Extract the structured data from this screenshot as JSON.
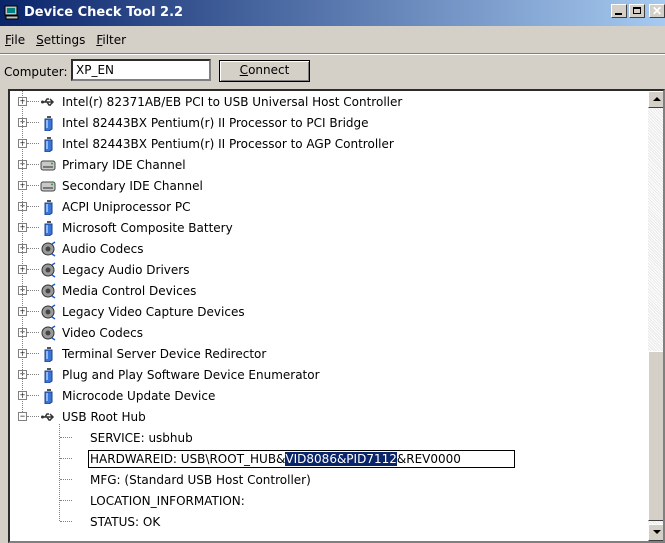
{
  "window": {
    "title": "Device Check Tool 2.2",
    "close_glyph": "✕"
  },
  "menu": [
    {
      "key": "F",
      "rest": "ile"
    },
    {
      "key": "S",
      "rest": "ettings"
    },
    {
      "key": "F",
      "rest": "ilter"
    }
  ],
  "toolbar": {
    "computer_label": "Computer:",
    "computer_value": "XP_EN",
    "connect_key": "C",
    "connect_rest": "onnect"
  },
  "tree": {
    "nodes": [
      {
        "label": "Intel(r) 82371AB/EB PCI to USB Universal Host Controller",
        "icon": "usb-icon",
        "expander": "+"
      },
      {
        "label": "Intel 82443BX Pentium(r) II Processor to PCI Bridge",
        "icon": "device-icon",
        "expander": "+"
      },
      {
        "label": "Intel 82443BX Pentium(r) II Processor to AGP Controller",
        "icon": "device-icon",
        "expander": "+"
      },
      {
        "label": "Primary IDE Channel",
        "icon": "drive-icon",
        "expander": "+"
      },
      {
        "label": "Secondary IDE Channel",
        "icon": "drive-icon",
        "expander": "+"
      },
      {
        "label": "ACPI Uniprocessor PC",
        "icon": "device-icon",
        "expander": "+"
      },
      {
        "label": "Microsoft Composite Battery",
        "icon": "device-icon",
        "expander": "+"
      },
      {
        "label": "Audio Codecs",
        "icon": "audio-icon",
        "expander": "+"
      },
      {
        "label": "Legacy Audio Drivers",
        "icon": "audio-icon",
        "expander": "+"
      },
      {
        "label": "Media Control Devices",
        "icon": "audio-icon",
        "expander": "+"
      },
      {
        "label": "Legacy Video Capture Devices",
        "icon": "audio-icon",
        "expander": "+"
      },
      {
        "label": "Video Codecs",
        "icon": "audio-icon",
        "expander": "+"
      },
      {
        "label": "Terminal Server Device Redirector",
        "icon": "device-icon",
        "expander": "+"
      },
      {
        "label": "Plug and Play Software Device Enumerator",
        "icon": "device-icon",
        "expander": "+"
      },
      {
        "label": "Microcode Update Device",
        "icon": "device-icon",
        "expander": "+"
      },
      {
        "label": "USB Root Hub",
        "icon": "usb-icon",
        "expander": "−"
      }
    ],
    "children": {
      "service": "SERVICE: usbhub",
      "hwid_prefix": "HARDWAREID: USB\\ROOT_HUB&",
      "hwid_selected": "VID8086&PID7112",
      "hwid_suffix": "&REV0000",
      "mfg": "MFG: (Standard USB Host Controller)",
      "location": "LOCATION_INFORMATION:",
      "status": "STATUS: OK"
    }
  }
}
